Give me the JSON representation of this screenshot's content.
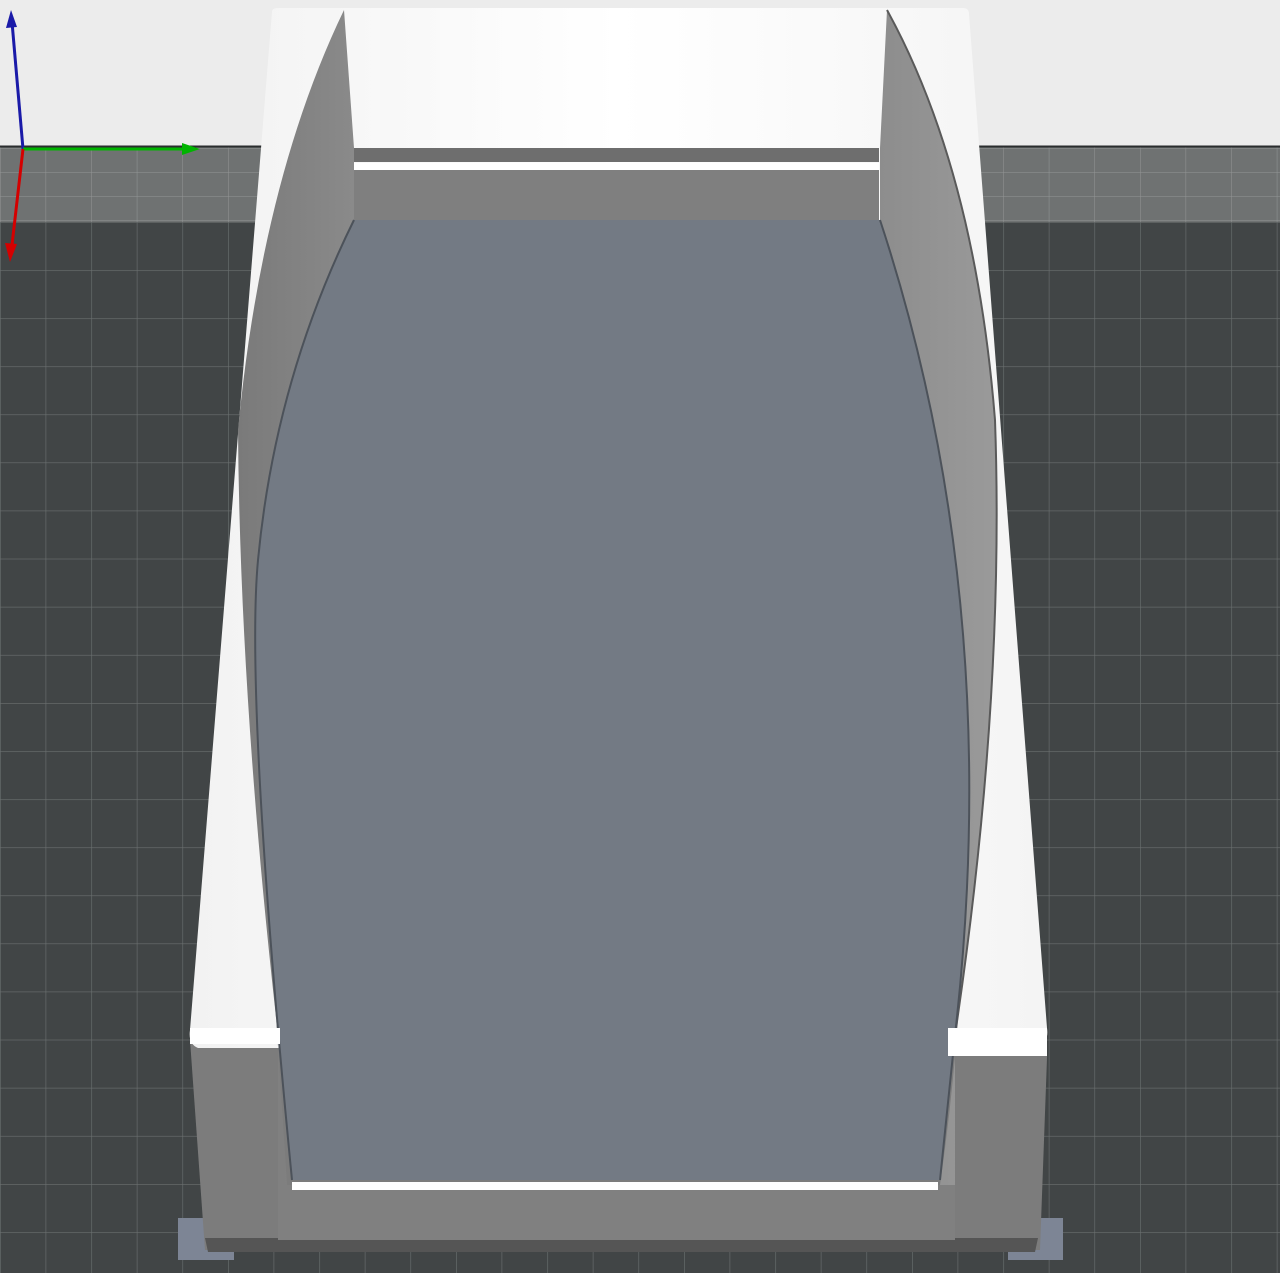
{
  "viewport": {
    "background_top": "#ececec",
    "bed_color": "#414546",
    "bed_grid_color": "#6b7070",
    "bed_far_strip_color": "#6f7272",
    "bed_far_grid_color": "#939696"
  },
  "model": {
    "selected_color": "#737a84",
    "shell_white": "#ffffff",
    "wall_gray": "#808080",
    "wall_shadow": "#6d6d6d",
    "foot_color": "#7d8595"
  },
  "gizmo": {
    "x_axis_color": "#d40000",
    "y_axis_color": "#00b400",
    "z_axis_color": "#1a1aa8"
  }
}
